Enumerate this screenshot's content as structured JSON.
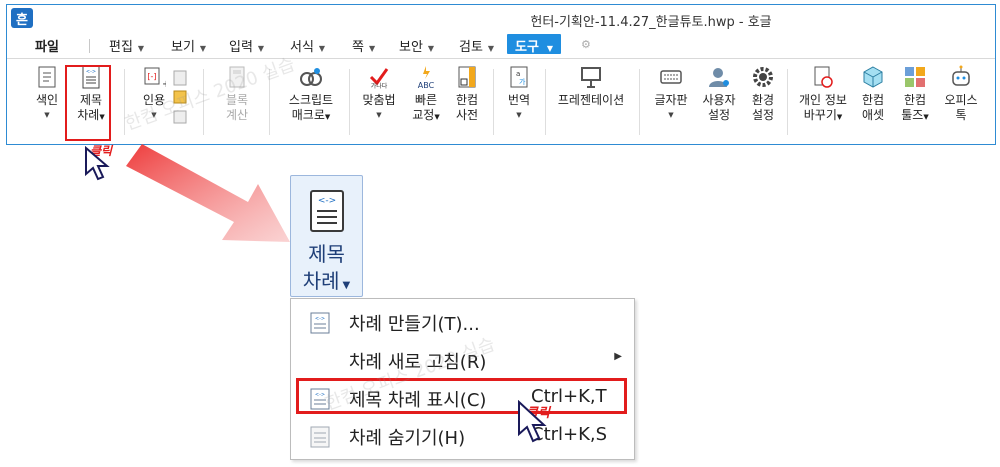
{
  "window": {
    "logo": "흔",
    "title": "헌터-기획안-11.4.27_한글튜토.hwp - 호글"
  },
  "menu": {
    "file": "파일",
    "edit": "편집",
    "view": "보기",
    "insert": "입력",
    "format": "서식",
    "page": "쪽",
    "security": "보안",
    "review": "검토",
    "tools": "도구"
  },
  "ribbon": {
    "index": [
      "색인"
    ],
    "toc": [
      "제목",
      "차례"
    ],
    "quote": [
      "인용"
    ],
    "block_calc": [
      "블록",
      "계산"
    ],
    "script_macro": [
      "스크립트",
      "매크로"
    ],
    "spell": [
      "맞춤법"
    ],
    "quick_fix": [
      "빠른",
      "교정"
    ],
    "dictionary": [
      "한컴",
      "사전"
    ],
    "translate": [
      "번역"
    ],
    "presentation": [
      "프레젠테이션"
    ],
    "keyboard": [
      "글자판"
    ],
    "user_settings": [
      "사용자",
      "설정"
    ],
    "env_settings": [
      "환경",
      "설정"
    ],
    "privacy": [
      "개인 정보",
      "바꾸기"
    ],
    "hancom_asset": [
      "한컴",
      "애셋"
    ],
    "hancom_tools": [
      "한컴",
      "툴즈"
    ],
    "office_talk": [
      "오피스",
      "톡"
    ]
  },
  "callout": {
    "button_line1": "제목",
    "button_line2": "차례"
  },
  "dropdown": {
    "items": [
      {
        "label": "차례 만들기(T)...",
        "shortcut": ""
      },
      {
        "label": "차례 새로 고침(R)",
        "shortcut": ""
      },
      {
        "label": "제목 차례 표시(C)",
        "shortcut": "Ctrl+K,T"
      },
      {
        "label": "차례 숨기기(H)",
        "shortcut": "Ctrl+K,S"
      }
    ]
  },
  "annotations": {
    "click_label": "클릭",
    "watermark": "한컴 오피스 2020 실습"
  },
  "colors": {
    "accent": "#1f8ee0",
    "highlight": "#e21c1c",
    "callout_bg": "#e8f1fb"
  }
}
